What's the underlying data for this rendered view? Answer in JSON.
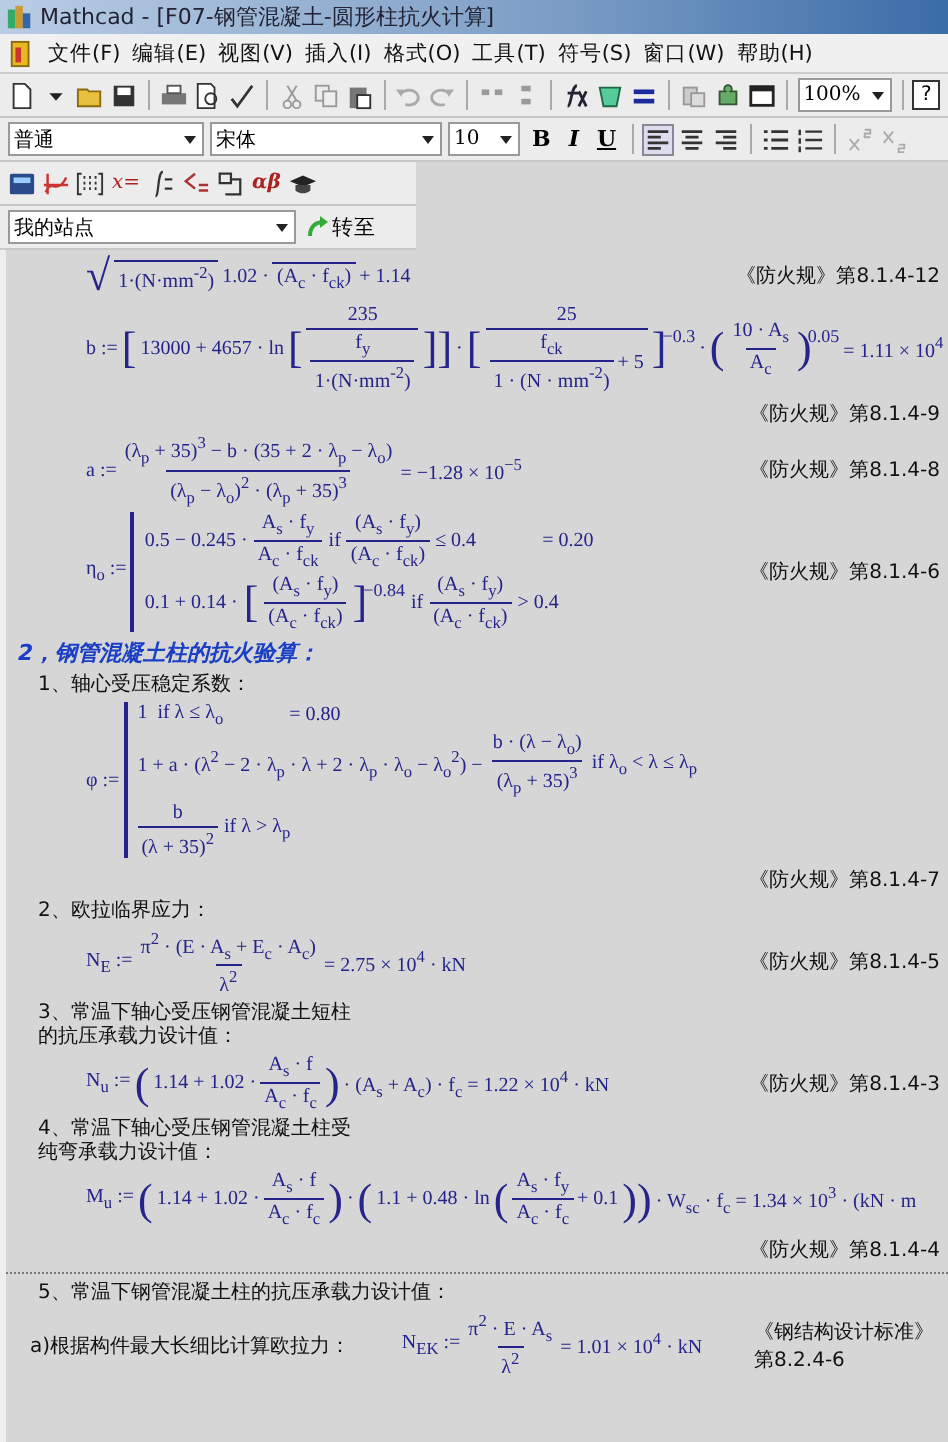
{
  "window": {
    "title": "Mathcad - [F07-钢管混凝土-圆形柱抗火计算]"
  },
  "menu": [
    "文件(F)",
    "编辑(E)",
    "视图(V)",
    "插入(I)",
    "格式(O)",
    "工具(T)",
    "符号(S)",
    "窗口(W)",
    "帮助(H)"
  ],
  "standard_toolbar": {
    "zoom": "100%",
    "help": "?"
  },
  "format_toolbar": {
    "style": "普通",
    "font": "宋体",
    "size": "10",
    "bold": "B",
    "italic": "I",
    "underline": "U"
  },
  "math_toolbar": {
    "evaluate": "x=",
    "greek": "αβ"
  },
  "resource_bar": {
    "site": "我的站点",
    "go": "转至"
  },
  "document": [
    {
      "kind": "formula",
      "ref": "《防火规》第8.1.4-12",
      "ref_below": false,
      "parts": [
        {
          "kind": "big",
          "text": "√"
        },
        {
          "kind": "frac",
          "den": "1·(N·mm$^{-2}$)"
        },
        {
          "kind": "t",
          "text": "1.02 ·"
        },
        {
          "kind": "frac",
          "den": "(A$_{c}$ · f$_{ck}$)"
        },
        {
          "kind": "t",
          "text": "+ 1.14"
        }
      ]
    },
    {
      "kind": "formula",
      "ref": "《防火规》第8.1.4-9",
      "ref_below": true,
      "parts": [
        {
          "kind": "t",
          "text": "b :="
        },
        {
          "kind": "big",
          "text": "["
        },
        {
          "kind": "t",
          "text": "13000 + 4657 · ln"
        },
        {
          "kind": "big",
          "text": "["
        },
        {
          "kind": "frac",
          "num": "235",
          "den": {
            "kind": "frac",
            "num": "f$_{y}$",
            "den": "1·(N·mm$^{-2}$)"
          }
        },
        {
          "kind": "big",
          "text": "]]"
        },
        {
          "kind": "t",
          "text": "·"
        },
        {
          "kind": "big",
          "text": "["
        },
        {
          "kind": "frac",
          "num": "25",
          "den": [
            {
              "kind": "frac",
              "num": "f$_{ck}$",
              "den": "1 · (N · mm$^{-2}$)"
            },
            {
              "kind": "t",
              "text": "+ 5"
            }
          ]
        },
        {
          "kind": "big",
          "text": "]",
          "sup": "−0.3"
        },
        {
          "kind": "t",
          "text": "·"
        },
        {
          "kind": "big",
          "text": "("
        },
        {
          "kind": "frac",
          "num": "10 · A$_{s}$",
          "den": "A$_{c}$"
        },
        {
          "kind": "big",
          "text": ")",
          "sup": "0.05"
        },
        {
          "kind": "t",
          "text": "= 1.11 × 10$^{4}$"
        }
      ]
    },
    {
      "kind": "formula",
      "ref": "《防火规》第8.1.4-8",
      "ref_below": false,
      "parts": [
        {
          "kind": "t",
          "text": "a :="
        },
        {
          "kind": "frac",
          "num": "(λ$_{p}$ + 35)$^{3}$ − b · (35 + 2 · λ$_{p}$ − λ$_{o}$)",
          "den": "(λ$_{p}$ − λ$_{o}$)$^{2}$ · (λ$_{p}$ + 35)$^{3}$"
        },
        {
          "kind": "t",
          "text": "= −1.28 × 10$^{−5}$"
        }
      ]
    },
    {
      "kind": "formula",
      "ref": "《防火规》第8.1.4-6",
      "ref_below": false,
      "parts": [
        {
          "kind": "t",
          "text": "η$_{o}$ :="
        },
        {
          "kind": "cases",
          "lines": [
            {
              "parts": [
                {
                  "kind": "t",
                  "text": "0.5 − 0.245 ·"
                },
                {
                  "kind": "frac",
                  "num": "A$_{s}$ · f$_{y}$",
                  "den": "A$_{c}$ · f$_{ck}$"
                },
                {
                  "kind": "t",
                  "text": "if"
                },
                {
                  "kind": "frac",
                  "num": "(A$_{s}$ · f$_{y}$)",
                  "den": "(A$_{c}$ · f$_{ck}$)"
                },
                {
                  "kind": "t",
                  "text": "≤ 0.4"
                },
                {
                  "kind": "result",
                  "text": "= 0.20"
                }
              ]
            },
            {
              "parts": [
                {
                  "kind": "t",
                  "text": "0.1 + 0.14 ·"
                },
                {
                  "kind": "big",
                  "text": "["
                },
                {
                  "kind": "frac",
                  "num": "(A$_{s}$ · f$_{y}$)",
                  "den": "(A$_{c}$ · f$_{ck}$)"
                },
                {
                  "kind": "big",
                  "text": "]",
                  "sup": "−0.84"
                },
                {
                  "kind": "t",
                  "text": "if"
                },
                {
                  "kind": "frac",
                  "num": "(A$_{s}$ · f$_{y}$)",
                  "den": "(A$_{c}$ · f$_{ck}$)"
                },
                {
                  "kind": "t",
                  "text": "> 0.4"
                }
              ]
            }
          ]
        }
      ]
    },
    {
      "kind": "heading",
      "text": "2，钢管混凝土柱的抗火验算："
    },
    {
      "kind": "label",
      "text": "1、轴心受压稳定系数："
    },
    {
      "kind": "formula",
      "ref": "《防火规》第8.1.4-7",
      "ref_below": true,
      "parts": [
        {
          "kind": "t",
          "text": "φ :="
        },
        {
          "kind": "cases",
          "lines": [
            {
              "parts": [
                {
                  "kind": "t",
                  "text": "1  if λ ≤ λ$_{o}$"
                },
                {
                  "kind": "result",
                  "text": "= 0.80"
                }
              ]
            },
            {
              "parts": [
                {
                  "kind": "t",
                  "text": "1 + a · (λ$^{2}$ − 2 · λ$_{p}$ · λ + 2 · λ$_{p}$ · λ$_{o}$ − λ$_{o}$$^{2}$) −"
                },
                {
                  "kind": "frac",
                  "num": "b · (λ − λ$_{o}$)",
                  "den": "(λ$_{p}$ + 35)$^{3}$"
                },
                {
                  "kind": "t",
                  "text": "if λ$_{o}$ < λ ≤ λ$_{p}$"
                }
              ]
            },
            {
              "parts": [
                {
                  "kind": "frac",
                  "num": "b",
                  "den": "(λ + 35)$^{2}$"
                },
                {
                  "kind": "t",
                  "text": "if λ > λ$_{p}$"
                }
              ]
            }
          ]
        }
      ]
    },
    {
      "kind": "label",
      "text": "2、欧拉临界应力："
    },
    {
      "kind": "formula",
      "ref": "《防火规》第8.1.4-5",
      "ref_below": false,
      "parts": [
        {
          "kind": "t",
          "text": "N$_{E}$ :="
        },
        {
          "kind": "frac",
          "num": "π$^{2}$ · (E · A$_{s}$ + E$_{c}$ · A$_{c}$)",
          "den": "λ$^{2}$"
        },
        {
          "kind": "t",
          "text": "= 2.75 × 10$^{4}$ · kN"
        }
      ]
    },
    {
      "kind": "label",
      "text": "3、常温下轴心受压钢管混凝土短柱的抗压承载力设计值："
    },
    {
      "kind": "formula",
      "ref": "《防火规》第8.1.4-3",
      "ref_below": false,
      "parts": [
        {
          "kind": "t",
          "text": "N$_{u}$ :="
        },
        {
          "kind": "big",
          "text": "("
        },
        {
          "kind": "t",
          "text": "1.14 + 1.02 ·"
        },
        {
          "kind": "frac",
          "num": "A$_{s}$ · f",
          "den": "A$_{c}$ · f$_{c}$"
        },
        {
          "kind": "big",
          "text": ")"
        },
        {
          "kind": "t",
          "text": "· (A$_{s}$ + A$_{c}$) · f$_{c}$ = 1.22 × 10$^{4}$ · kN"
        }
      ]
    },
    {
      "kind": "label",
      "text": "4、常温下轴心受压钢管混凝土柱受纯弯承载力设计值："
    },
    {
      "kind": "formula",
      "ref": "《防火规》第8.1.4-4",
      "ref_below": true,
      "parts": [
        {
          "kind": "t",
          "text": "M$_{u}$ :="
        },
        {
          "kind": "big",
          "text": "("
        },
        {
          "kind": "t",
          "text": "1.14 + 1.02 ·"
        },
        {
          "kind": "frac",
          "num": "A$_{s}$ · f",
          "den": "A$_{c}$ · f$_{c}$"
        },
        {
          "kind": "big",
          "text": ")"
        },
        {
          "kind": "t",
          "text": "·"
        },
        {
          "kind": "big",
          "text": "("
        },
        {
          "kind": "t",
          "text": "1.1 + 0.48 · ln"
        },
        {
          "kind": "big",
          "text": "("
        },
        {
          "kind": "frac",
          "num": "A$_{s}$ · f$_{y}$",
          "den": "A$_{c}$ · f$_{c}$"
        },
        {
          "kind": "t",
          "text": "+ 0.1"
        },
        {
          "kind": "big",
          "text": "))"
        },
        {
          "kind": "t",
          "text": "· W$_{sc}$ · f$_{c}$ = 1.34 × 10$^{3}$ · (kN · m"
        }
      ]
    },
    {
      "kind": "separator"
    },
    {
      "kind": "label",
      "text": "5、常温下钢管混凝土柱的抗压承载力设计值："
    },
    {
      "kind": "formula",
      "label": "a)根据构件最大长细比计算欧拉力：",
      "ref": "《钢结构设计标准》第8.2.4-6",
      "ref_below": false,
      "parts": [
        {
          "kind": "t",
          "text": "N$_{EK}$ :="
        },
        {
          "kind": "frac",
          "num": "π$^{2}$ · E · A$_{s}$",
          "den": "λ$^{2}$"
        },
        {
          "kind": "t",
          "text": "= 1.01 × 10$^{4}$ · kN"
        }
      ]
    }
  ]
}
